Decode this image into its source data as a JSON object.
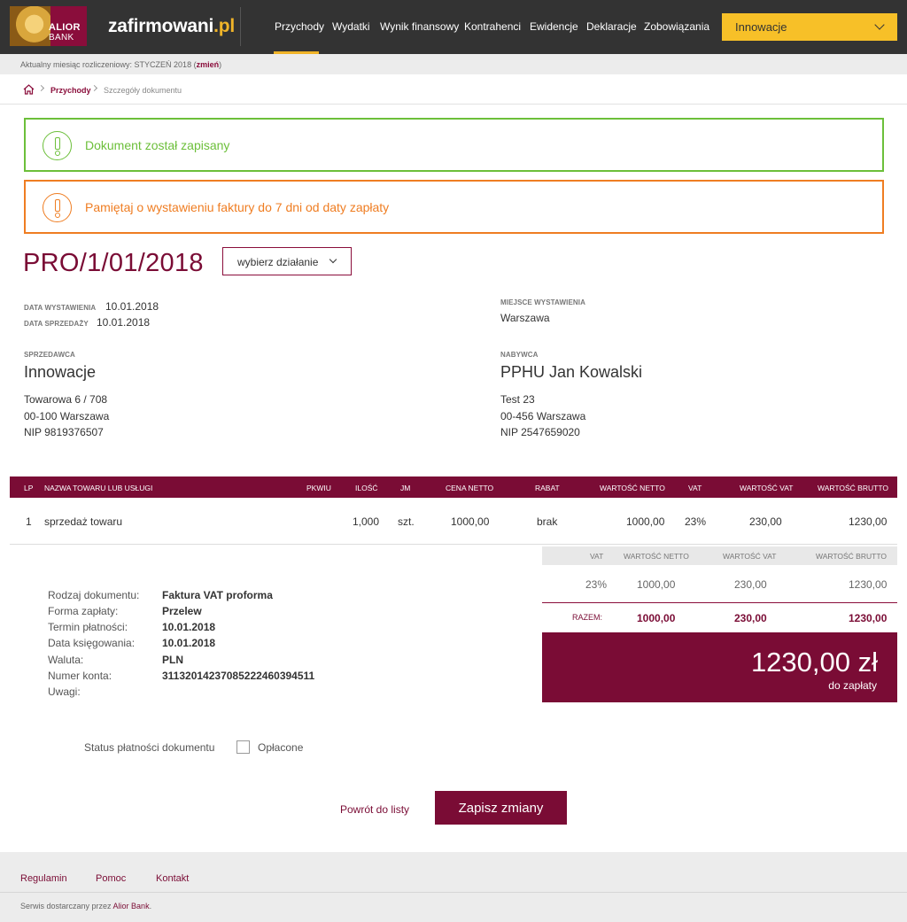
{
  "header": {
    "logo": {
      "line1": "ALIOR",
      "line2": "BANK"
    },
    "brand": {
      "name": "zafirmowani",
      "tld": ".pl"
    },
    "nav": [
      {
        "label": "Przychody",
        "active": true
      },
      {
        "label": "Wydatki"
      },
      {
        "label": "Wynik finansowy"
      },
      {
        "label": "Kontrahenci"
      },
      {
        "label": "Ewidencje"
      },
      {
        "label": "Deklaracje"
      },
      {
        "label": "Zobowiązania"
      }
    ],
    "company_select": "Innowacje",
    "accent": "#f0b429"
  },
  "month_bar": {
    "text": "Aktualny miesiąc rozliczeniowy: STYCZEŃ 2018 (",
    "link": "zmień",
    "suffix": ")"
  },
  "breadcrumb": {
    "home_icon": "home-icon",
    "parent": "Przychody",
    "current": "Szczegóły dokumentu"
  },
  "alerts": {
    "success": "Dokument został zapisany",
    "warning": "Pamiętaj o wystawieniu faktury do 7 dni od daty zapłaty",
    "success_color": "#6cbf3a",
    "warning_color": "#ef7d22"
  },
  "document": {
    "number": "PRO/1/01/2018",
    "action_select": "wybierz działanie",
    "issue_date_label": "DATA WYSTAWIENIA",
    "issue_date": "10.01.2018",
    "sale_date_label": "DATA SPRZEDAŻY",
    "sale_date": "10.01.2018",
    "place_label": "MIEJSCE WYSTAWIENIA",
    "place": "Warszawa"
  },
  "seller": {
    "label": "SPRZEDAWCA",
    "name": "Innowacje",
    "street": "Towarowa 6 / 708",
    "city": "00-100 Warszawa",
    "nip": "NIP 9819376507"
  },
  "buyer": {
    "label": "NABYWCA",
    "name": "PPHU Jan Kowalski",
    "street": "Test 23",
    "city": "00-456 Warszawa",
    "nip": "NIP 2547659020"
  },
  "items_table": {
    "columns": [
      "LP",
      "NAZWA TOWARU LUB USŁUGI",
      "PKWIU",
      "ILOŚĆ",
      "JM",
      "CENA NETTO",
      "RABAT",
      "WARTOŚĆ NETTO",
      "VAT",
      "WARTOŚĆ VAT",
      "WARTOŚĆ BRUTTO"
    ],
    "rows": [
      {
        "lp": "1",
        "name": "sprzedaż towaru",
        "pkwiu": "",
        "qty": "1,000",
        "unit": "szt.",
        "price_net": "1000,00",
        "discount": "brak",
        "value_net": "1000,00",
        "vat": "23%",
        "value_vat": "230,00",
        "value_gross": "1230,00"
      }
    ]
  },
  "summary": {
    "columns": [
      "VAT",
      "WARTOŚĆ NETTO",
      "WARTOŚĆ VAT",
      "WARTOŚĆ BRUTTO"
    ],
    "row": {
      "vat": "23%",
      "net": "1000,00",
      "vat_value": "230,00",
      "gross": "1230,00"
    },
    "total": {
      "label": "RAZEM:",
      "net": "1000,00",
      "vat_value": "230,00",
      "gross": "1230,00"
    },
    "to_pay_amount": "1230,00 zł",
    "to_pay_label": "do zapłaty"
  },
  "details": [
    {
      "key": "Rodzaj dokumentu:",
      "value": "Faktura VAT proforma"
    },
    {
      "key": "Forma zapłaty:",
      "value": "Przelew"
    },
    {
      "key": "Termin płatności:",
      "value": "10.01.2018"
    },
    {
      "key": "Data księgowania:",
      "value": "10.01.2018"
    },
    {
      "key": "Waluta:",
      "value": "PLN"
    },
    {
      "key": "Numer konta:",
      "value": "31132014237085222460394511"
    },
    {
      "key": "Uwagi:",
      "value": ""
    }
  ],
  "payment_status": {
    "label": "Status płatności dokumentu",
    "checkbox_label": "Opłacone",
    "checked": false
  },
  "actions": {
    "back": "Powrót do listy",
    "save": "Zapisz zmiany"
  },
  "footer": {
    "links": [
      "Regulamin",
      "Pomoc",
      "Kontakt"
    ],
    "copy_prefix": "Serwis dostarczany przez ",
    "copy_brand": "Alior Bank",
    "copy_suffix": "."
  },
  "colors": {
    "brand": "#7a0c35",
    "header_bg": "#333333"
  }
}
